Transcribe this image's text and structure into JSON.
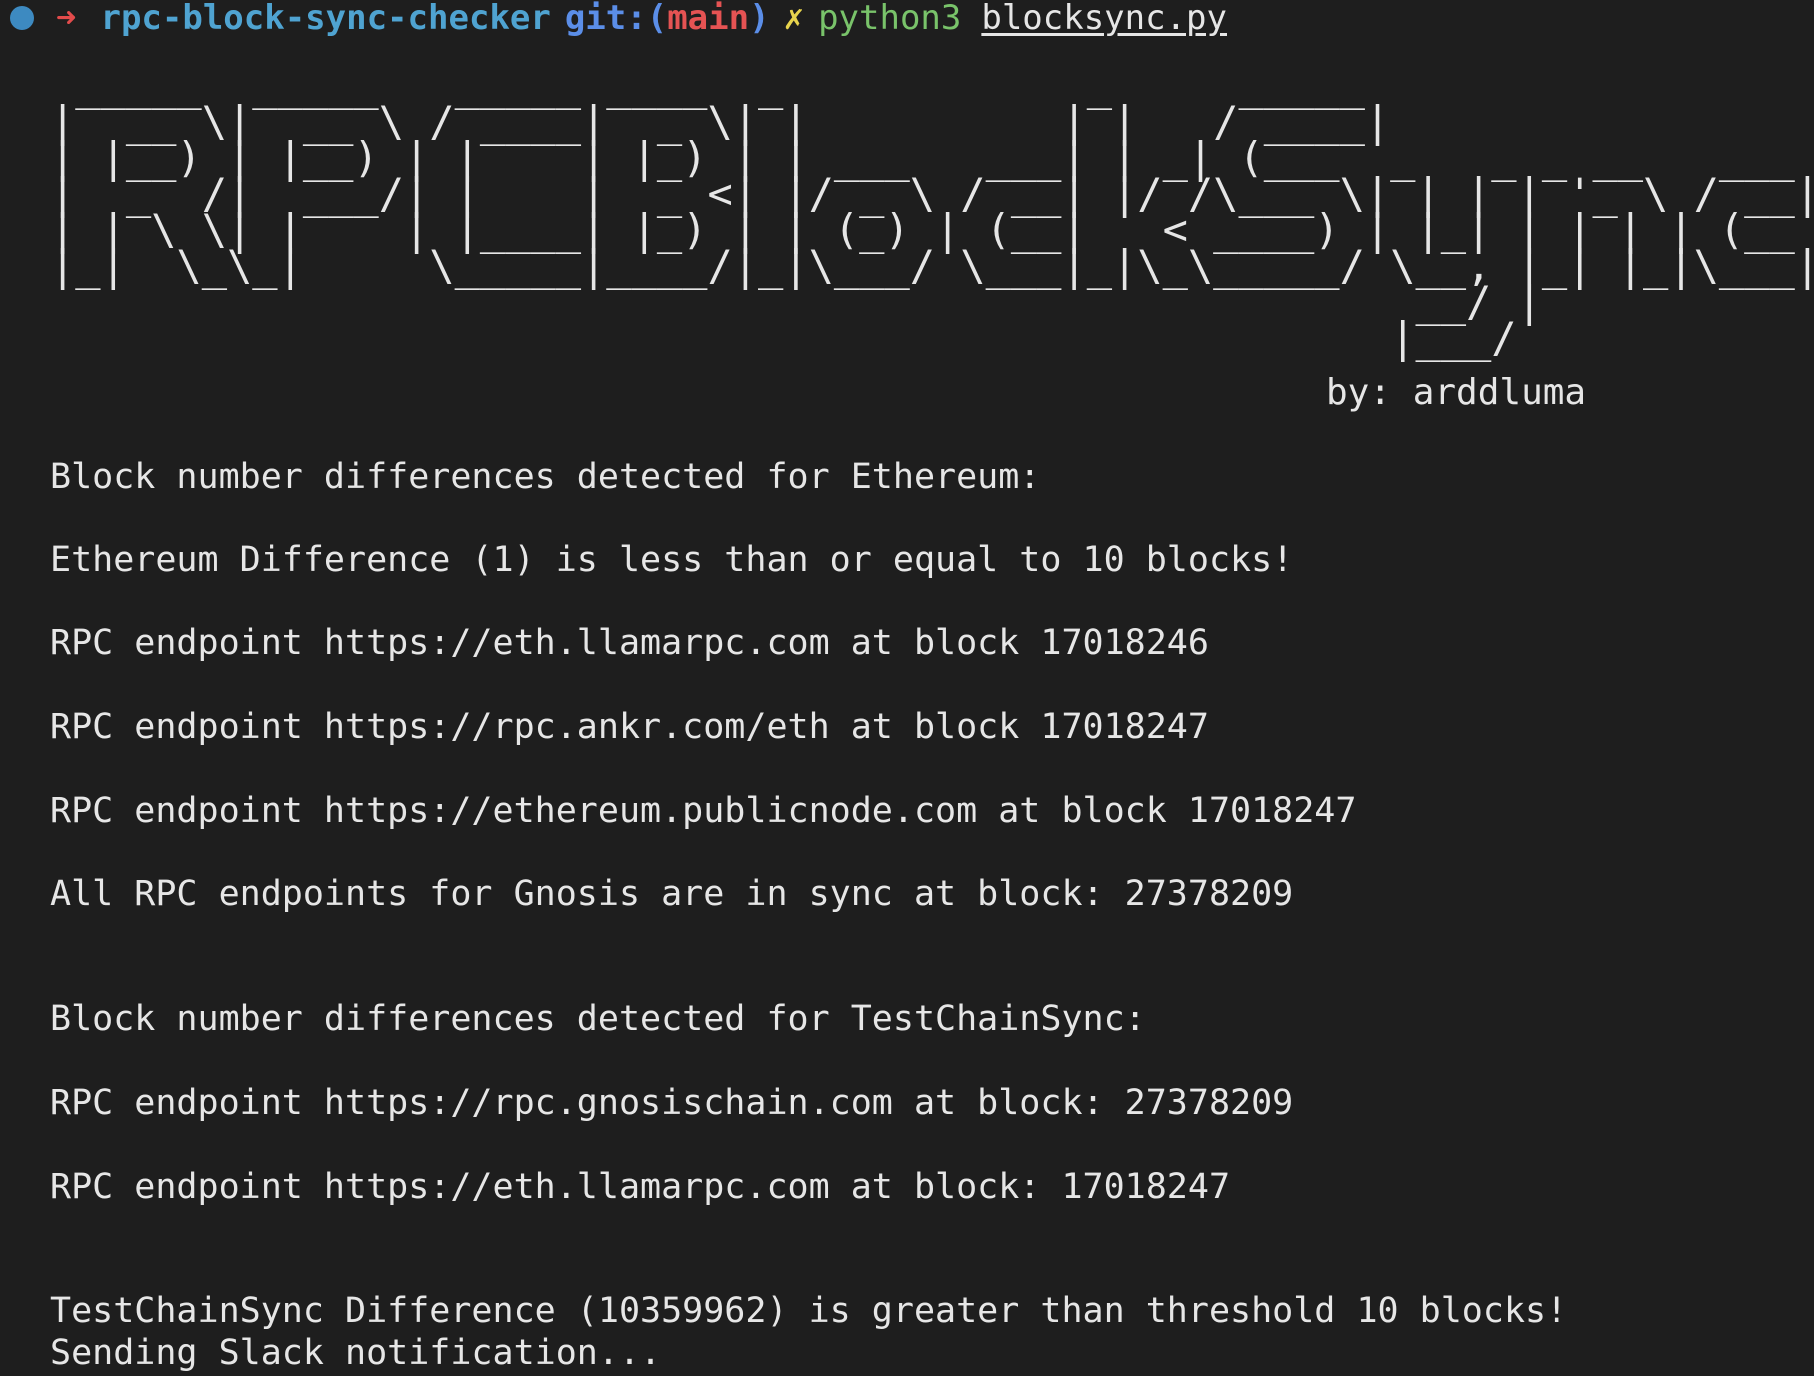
{
  "prompt": {
    "arrow": "➜",
    "directory": "rpc-block-sync-checker",
    "git_label": "git:",
    "branch_open": "(",
    "branch": "main",
    "branch_close": ")",
    "dirty_mark": "✗",
    "command": "python3",
    "argument": "blocksync.py"
  },
  "banner": {
    "ascii_art": " _____  _____   _____ ____  _            _     _____\n|  __ \\|  __ \\ / ____|  _ \\| |          | |   / ____|\n| |__) | |__) | |    | |_) | | ___   ___| | _| (___  _   _ _ __   ___\n|  _  /|  ___/| |    |  _ <| |/ _ \\ / __| |/ /\\___ \\| | | | '_ \\ / __|\n| | \\ \\| |    | |____| |_) | | (_) | (__|   < ____) | |_| | | | | (__\n|_|  \\_\\_|     \\_____|____/|_|\\___/ \\___|_|\\_\\_____/ \\__, |_| |_|\\___|\n                                                      __/ |\n                                                     |___/",
    "byline": "by: arddluma"
  },
  "output_lines": [
    "Block number differences detected for Ethereum:",
    "Ethereum Difference (1) is less than or equal to 10 blocks!",
    "RPC endpoint https://eth.llamarpc.com at block 17018246",
    "RPC endpoint https://rpc.ankr.com/eth at block 17018247",
    "RPC endpoint https://ethereum.publicnode.com at block 17018247",
    "All RPC endpoints for Gnosis are in sync at block: 27378209",
    "Block number differences detected for TestChainSync:",
    "RPC endpoint https://rpc.gnosischain.com at block: 27378209",
    "RPC endpoint https://eth.llamarpc.com at block: 17018247",
    "TestChainSync Difference (10359962) is greater than threshold 10 blocks!",
    "Sending Slack notification..."
  ],
  "colors": {
    "background": "#1e1e1e",
    "foreground": "#e6e6e6",
    "status_dot": "#3d8ac1",
    "arrow": "#e24b4b",
    "directory": "#4fa3d1",
    "git_label": "#5b8ee8",
    "branch": "#e55353",
    "dirty_mark": "#e8d44d",
    "command": "#79c36a",
    "argument": "#e6e6e6"
  }
}
